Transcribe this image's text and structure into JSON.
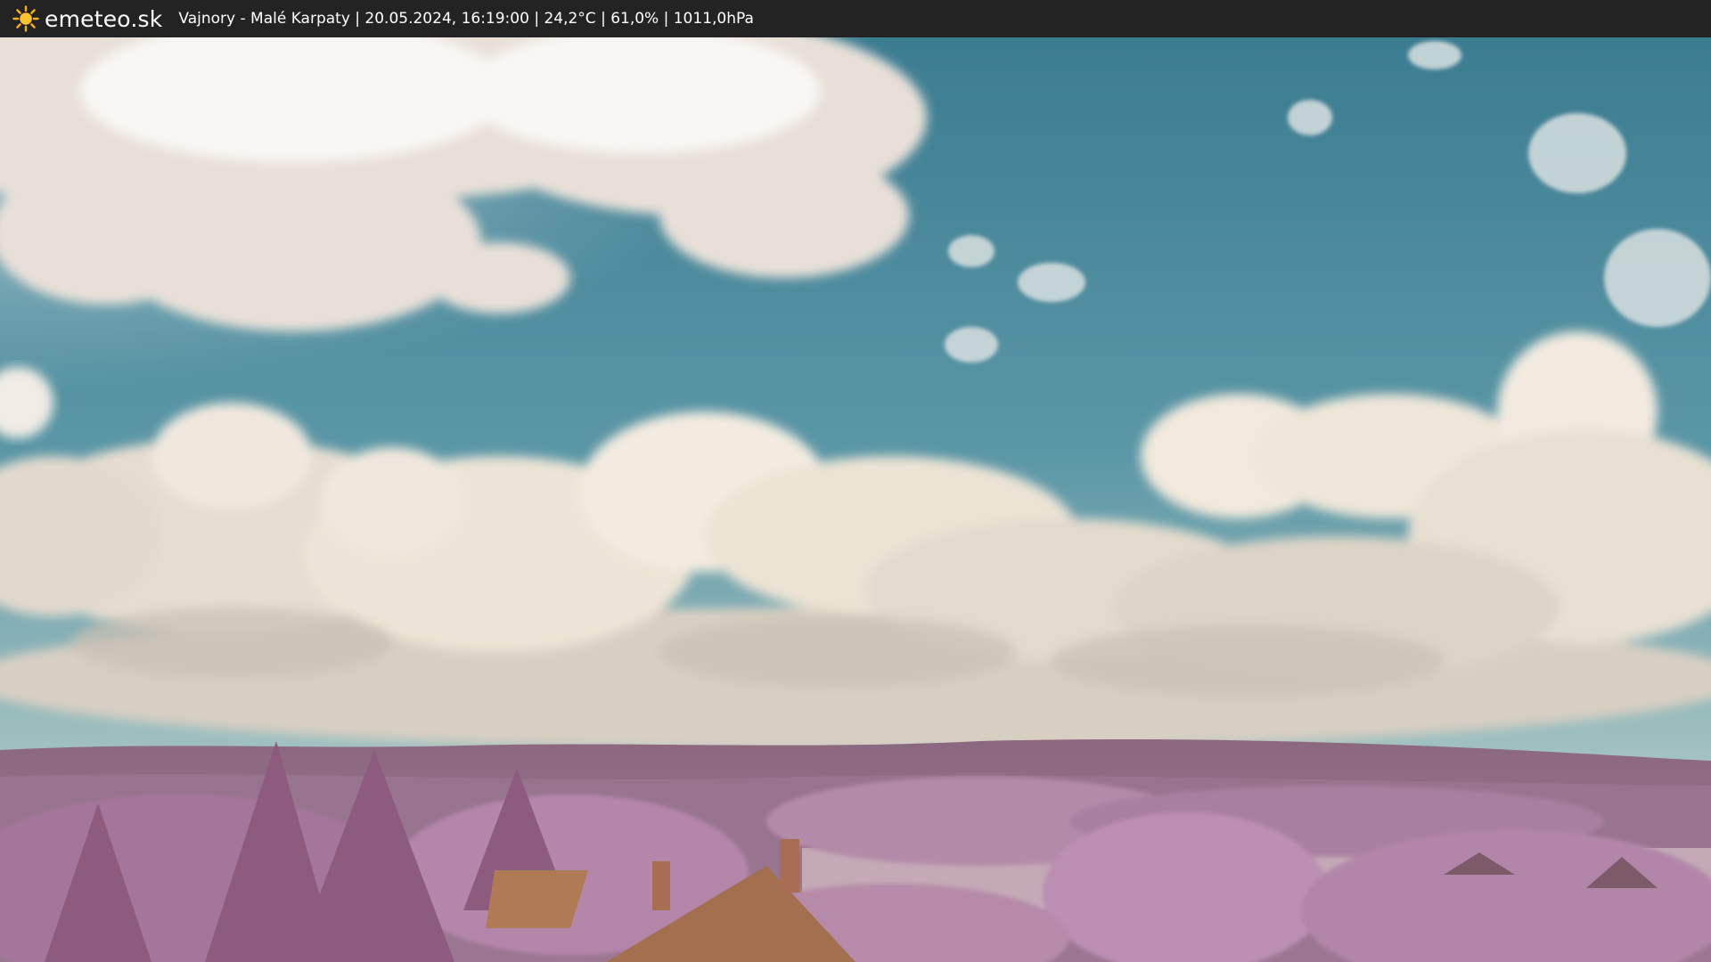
{
  "header": {
    "logo_text": "emeteo.sk",
    "logo_icon": "sun-icon",
    "caption": "Vajnory - Malé Karpaty | 20.05.2024, 16:19:00 | 24,2°C | 61,0% | 1011,0hPa"
  },
  "scene": {
    "content": "webcam-photo",
    "colors": {
      "sky_top": "#3f7d90",
      "sky_bottom": "#86b3bd",
      "clouds": "#efe7dc",
      "hills": "#8f6a82",
      "foliage": "#b07fa5",
      "roofs": "#a06e52"
    }
  }
}
